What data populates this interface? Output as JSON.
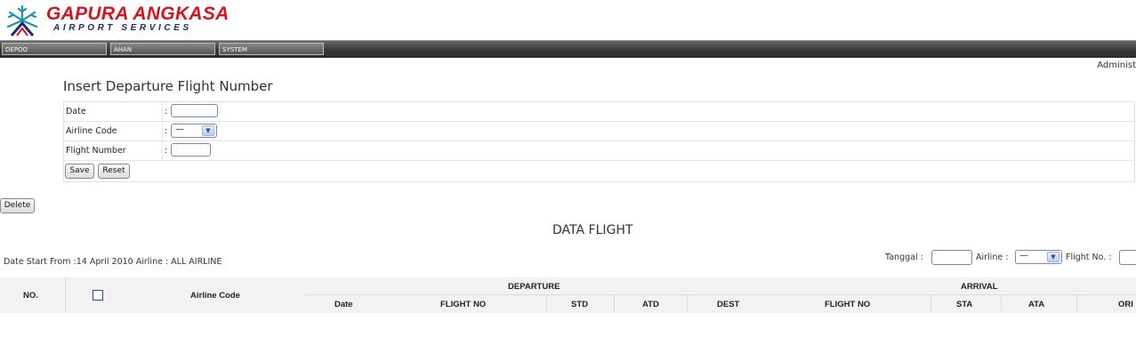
{
  "brand": {
    "name": "GAPURA ANGKASA",
    "tagline": "AIRPORT SERVICES",
    "colors": {
      "red": "#d4151c",
      "navy": "#1a2a6c",
      "teal": "#1d8fb0"
    }
  },
  "menu": [
    {
      "label": "DEPOO"
    },
    {
      "label": "AHAN"
    },
    {
      "label": "SYSTEM"
    }
  ],
  "user": {
    "label": "Administ"
  },
  "form": {
    "title": "Insert Departure Flight Number",
    "date_label": "Date",
    "airline_label": "Airline Code",
    "flight_label": "Flight Number",
    "colon": ":",
    "date_value": "",
    "airline_value": "—",
    "flight_value": "",
    "save_label": "Save",
    "reset_label": "Reset"
  },
  "delete_label": "Delete",
  "data_title": "DATA FLIGHT",
  "filter_info": "Date Start From :14 April 2010   Airline : ALL AIRLINE",
  "filter": {
    "tanggal_label": "Tanggal :",
    "airline_label": "Airline :",
    "airline_value": "—",
    "flightno_label": "Flight No. :"
  },
  "table": {
    "no": "NO.",
    "airline_code": "Airline Code",
    "departure": "DEPARTURE",
    "arrival": "ARRIVAL",
    "dep_cols": [
      "Date",
      "FLIGHT NO",
      "STD",
      "ATD",
      "DEST"
    ],
    "arr_cols": [
      "FLIGHT NO",
      "STA",
      "ATA",
      "ORI"
    ]
  }
}
